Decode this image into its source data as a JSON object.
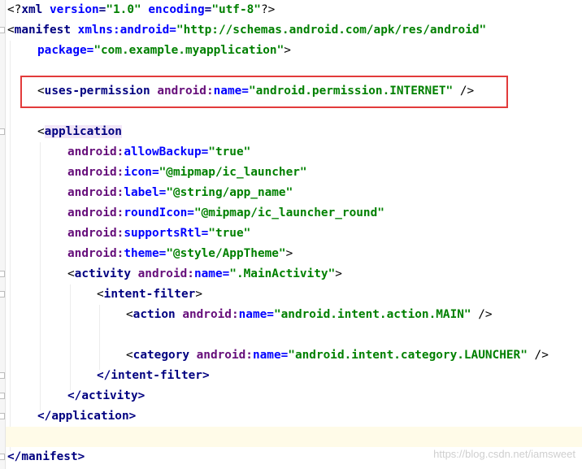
{
  "code": {
    "line1": {
      "open": "<?",
      "keyword": "xml",
      "attr1_name": "version",
      "attr1_value": "\"1.0\"",
      "attr2_name": "encoding",
      "attr2_value": "\"utf-8\"",
      "close": "?>"
    },
    "line2": {
      "open": "<",
      "tag": "manifest",
      "ns": "xmlns:",
      "attr": "android",
      "eq": "=",
      "value": "\"http://schemas.android.com/apk/res/android\""
    },
    "line3": {
      "attr": "package",
      "eq": "=",
      "value": "\"com.example.myapplication\"",
      "close": ">"
    },
    "line5": {
      "open": "<",
      "tag": "uses-permission",
      "ns": "android:",
      "attr": "name",
      "eq": "=",
      "value": "\"android.permission.INTERNET\"",
      "close": " />"
    },
    "line7": {
      "open": "<",
      "tag": "application"
    },
    "attributes": [
      {
        "ns": "android:",
        "attr": "allowBackup",
        "eq": "=",
        "value": "\"true\""
      },
      {
        "ns": "android:",
        "attr": "icon",
        "eq": "=",
        "value": "\"@mipmap/ic_launcher\""
      },
      {
        "ns": "android:",
        "attr": "label",
        "eq": "=",
        "value": "\"@string/app_name\""
      },
      {
        "ns": "android:",
        "attr": "roundIcon",
        "eq": "=",
        "value": "\"@mipmap/ic_launcher_round\""
      },
      {
        "ns": "android:",
        "attr": "supportsRtl",
        "eq": "=",
        "value": "\"true\""
      },
      {
        "ns": "android:",
        "attr": "theme",
        "eq": "=",
        "value": "\"@style/AppTheme\"",
        "close": ">"
      }
    ],
    "line14": {
      "open": "<",
      "tag": "activity",
      "ns": " android:",
      "attr": "name",
      "eq": "=",
      "value": "\".MainActivity\"",
      "close": ">"
    },
    "line15": {
      "open": "<",
      "tag": "intent-filter",
      "close": ">"
    },
    "line16": {
      "open": "<",
      "tag": "action",
      "ns": " android:",
      "attr": "name",
      "eq": "=",
      "value": "\"android.intent.action.MAIN\"",
      "close": " />"
    },
    "line18": {
      "open": "<",
      "tag": "category",
      "ns": " android:",
      "attr": "name",
      "eq": "=",
      "value": "\"android.intent.category.LAUNCHER\"",
      "close": " />"
    },
    "line19": {
      "text": "</intent-filter>"
    },
    "line20": {
      "text": "</activity>"
    },
    "line21": {
      "text": "</application>"
    },
    "line23": {
      "text": "</manifest>"
    }
  },
  "colors": {
    "tag": "#000080",
    "namespace": "#660e7a",
    "attribute": "#0000ff",
    "value": "#008000",
    "highlight_box": "#e23b3b",
    "caret_line": "#fffbe8"
  },
  "watermark": "https://blog.csdn.net/iamsweet"
}
